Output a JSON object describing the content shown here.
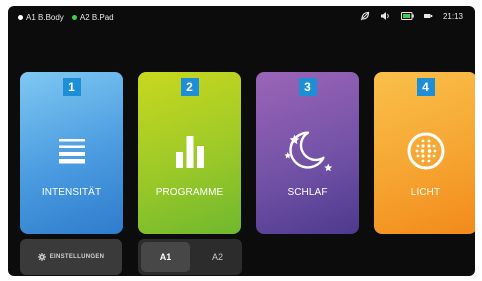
{
  "status": {
    "devices": [
      {
        "label": "A1 B.Body",
        "color": "#ffffff"
      },
      {
        "label": "A2 B.Pad",
        "color": "#3fcf4f"
      }
    ],
    "icons": [
      "leaf-off-icon",
      "volume-icon",
      "battery-icon",
      "battery-small-icon"
    ],
    "time": "21:13"
  },
  "tiles": [
    {
      "number": "1",
      "label": "INTENSITÄT",
      "icon": "intensity-lines-icon",
      "gradient": [
        "#7fc8f2",
        "#2f7ccd"
      ]
    },
    {
      "number": "2",
      "label": "PROGRAMME",
      "icon": "bar-chart-icon",
      "gradient": [
        "#c9d81f",
        "#6fb82e"
      ]
    },
    {
      "number": "3",
      "label": "SCHLAF",
      "icon": "moon-stars-icon",
      "gradient": [
        "#9b65b8",
        "#4d3a8e"
      ]
    },
    {
      "number": "4",
      "label": "LICHT",
      "icon": "light-dots-icon",
      "gradient": [
        "#f9c04a",
        "#f28a1a"
      ]
    }
  ],
  "settings": {
    "label": "EINSTELLUNGEN",
    "icon": "gear-icon"
  },
  "segment": {
    "options": [
      "A1",
      "A2"
    ],
    "selected": "A1"
  },
  "colors": {
    "background": "#0c0c0c",
    "badge": "#1e8fd6"
  }
}
